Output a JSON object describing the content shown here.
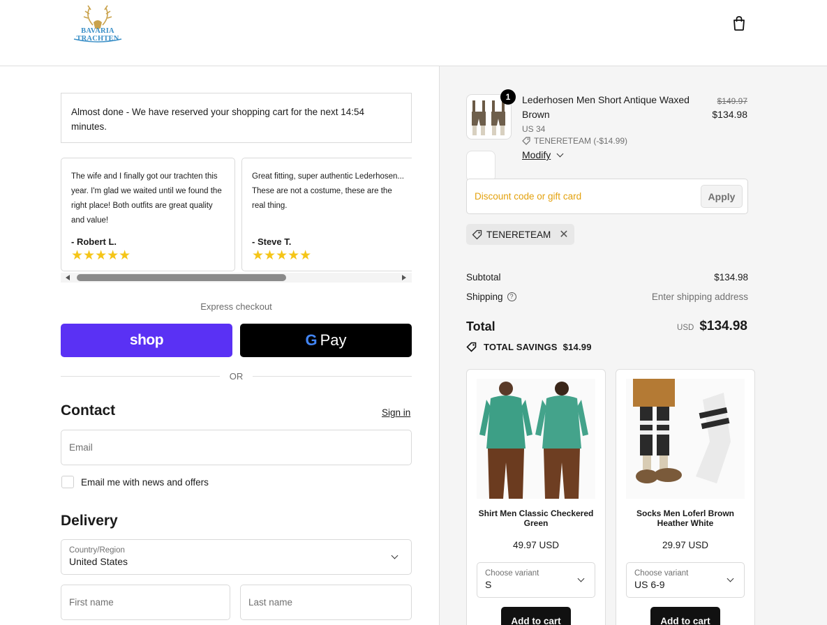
{
  "brand": {
    "logo_text": "BAVARIA TRACHTEN"
  },
  "header": {
    "cart_icon": "shopping-bag-icon"
  },
  "reservation": {
    "message": "Almost done - We have reserved your shopping cart for the next 14:54 minutes."
  },
  "reviews": [
    {
      "text": "The wife and I finally got our trachten this year. I'm glad we waited until we found the right place! Both outfits are great quality and value!",
      "author": "- Robert L.",
      "rating": 5,
      "stars": "★★★★★"
    },
    {
      "text": "Great fitting, super authentic Lederhosen... These are not a costume, these are the real thing.",
      "author": "- Steve T.",
      "rating": 5,
      "stars": "★★★★★"
    }
  ],
  "express": {
    "label": "Express checkout",
    "shop_label": "shop",
    "gpay_label": "Pay",
    "or_label": "OR"
  },
  "contact": {
    "heading": "Contact",
    "sign_in": "Sign in",
    "email_placeholder": "Email",
    "newsletter_label": "Email me with news and offers"
  },
  "delivery": {
    "heading": "Delivery",
    "country_label": "Country/Region",
    "country_value": "United States",
    "first_name_placeholder": "First name",
    "last_name_placeholder": "Last name"
  },
  "order": {
    "item": {
      "quantity": "1",
      "title": "Lederhosen Men Short Antique Waxed Brown",
      "variant": "US 34",
      "discount": "TENERETEAM (-$14.99)",
      "modify": "Modify",
      "price_original": "$149.97",
      "price": "$134.98"
    },
    "discount_placeholder": "Discount code or gift card",
    "apply_label": "Apply",
    "applied_code": "TENERETEAM",
    "subtotal_label": "Subtotal",
    "subtotal": "$134.98",
    "shipping_label": "Shipping",
    "shipping_value": "Enter shipping address",
    "total_label": "Total",
    "currency": "USD",
    "total": "$134.98",
    "savings_label": "TOTAL SAVINGS",
    "savings": "$14.99"
  },
  "upsells": [
    {
      "name": "Shirt Men Classic Checkered Green",
      "price": "49.97 USD",
      "variant_label": "Choose variant",
      "variant_value": "S",
      "add_label": "Add to cart"
    },
    {
      "name": "Socks Men Loferl Brown Heather White",
      "price": "29.97 USD",
      "variant_label": "Choose variant",
      "variant_value": "US 6-9",
      "add_label": "Add to cart"
    }
  ],
  "colors": {
    "shop_purple": "#5a31f4",
    "discount_placeholder": "#e3a10d",
    "star": "#f5c518"
  }
}
